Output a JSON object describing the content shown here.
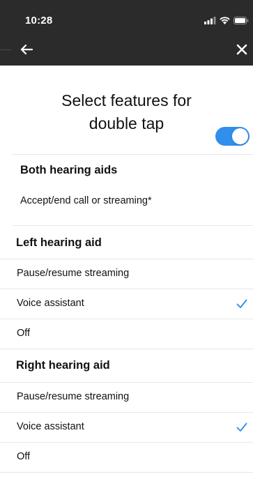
{
  "status_bar": {
    "time": "10:28",
    "icons": [
      "signal-icon",
      "wifi-icon",
      "battery-icon"
    ]
  },
  "nav": {
    "back_icon": "arrow-left-icon",
    "close_icon": "close-icon"
  },
  "page": {
    "title_line1": "Select features for",
    "title_line2": "double tap"
  },
  "both": {
    "header": "Both hearing aids",
    "toggle_label": "Accept/end call or streaming*",
    "toggle_on": true
  },
  "left": {
    "header": "Left hearing aid",
    "options": [
      {
        "label": "Pause/resume streaming",
        "selected": false
      },
      {
        "label": "Voice assistant",
        "selected": true
      },
      {
        "label": "Off",
        "selected": false
      }
    ]
  },
  "right": {
    "header": "Right hearing aid",
    "options": [
      {
        "label": "Pause/resume streaming",
        "selected": false
      },
      {
        "label": "Voice assistant",
        "selected": true
      },
      {
        "label": "Off",
        "selected": false
      }
    ]
  },
  "colors": {
    "accent": "#2f8fea",
    "bar": "#2b2b2b",
    "divider": "#e6e6e6"
  }
}
